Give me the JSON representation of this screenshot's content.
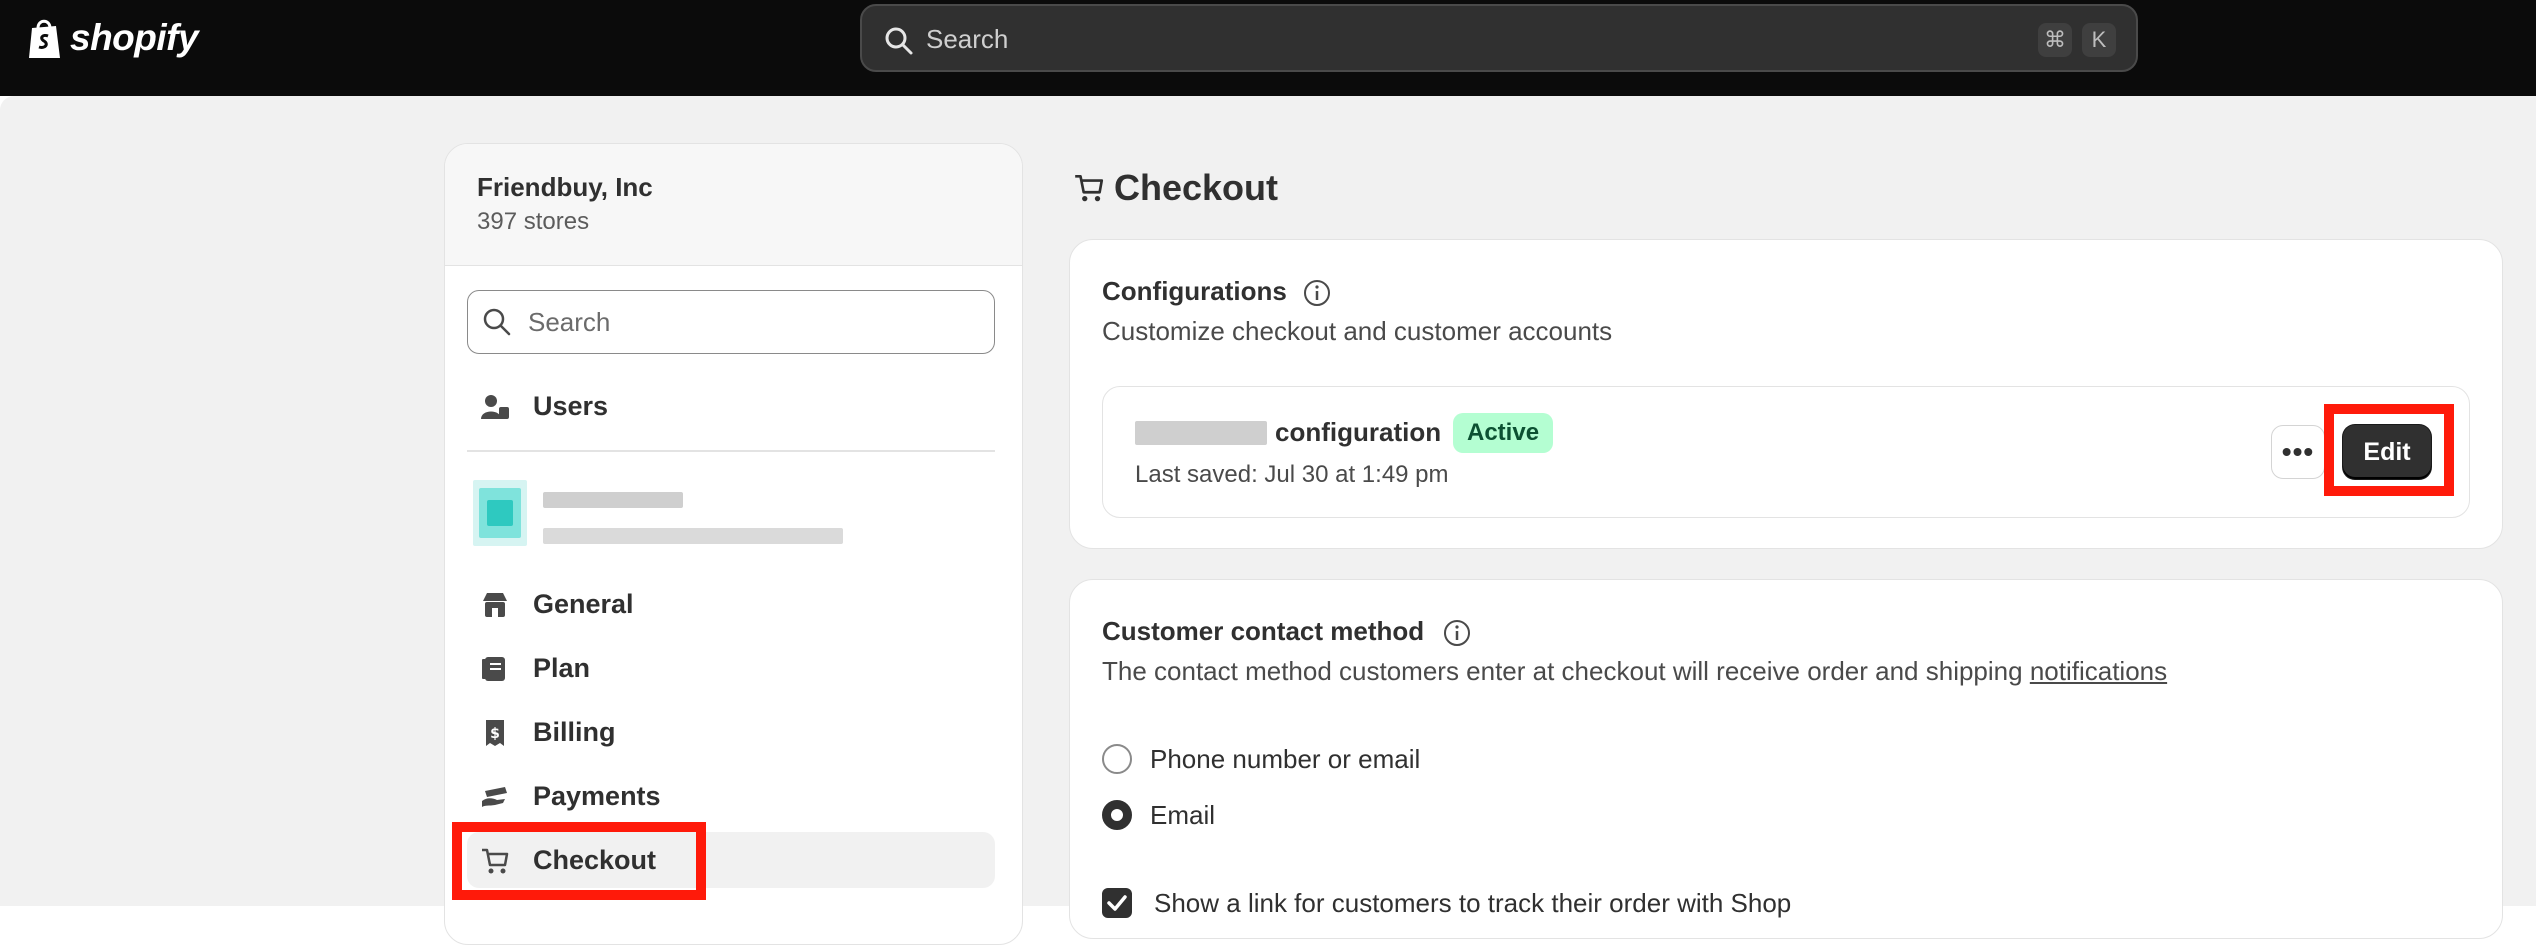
{
  "topbar": {
    "brand": "shopify",
    "search_placeholder": "Search",
    "shortcut_cmd": "⌘",
    "shortcut_key": "K"
  },
  "sidebar": {
    "org_name": "Friendbuy, Inc",
    "store_count": "397 stores",
    "search_placeholder": "Search",
    "items": [
      {
        "label": "Users",
        "icon": "users-icon"
      },
      {
        "label": "General",
        "icon": "store-icon"
      },
      {
        "label": "Plan",
        "icon": "plan-icon"
      },
      {
        "label": "Billing",
        "icon": "receipt-icon"
      },
      {
        "label": "Payments",
        "icon": "payments-icon"
      },
      {
        "label": "Checkout",
        "icon": "cart-icon",
        "active": true
      }
    ]
  },
  "main": {
    "title": "Checkout",
    "configurations": {
      "title": "Configurations",
      "subtitle": "Customize checkout and customer accounts",
      "config_name_suffix": "configuration",
      "status": "Active",
      "last_saved": "Last saved: Jul 30 at 1:49 pm",
      "more_label": "•••",
      "edit_label": "Edit"
    },
    "contact": {
      "title": "Customer contact method",
      "description_prefix": "The contact method customers enter at checkout will receive order and shipping ",
      "description_link": "notifications",
      "options": [
        {
          "label": "Phone number or email",
          "selected": false
        },
        {
          "label": "Email",
          "selected": true
        }
      ],
      "shop_tracking_label": "Show a link for customers to track their order with Shop"
    }
  },
  "colors": {
    "topbar": "#0b0b0b",
    "page_bg": "#f1f1f1",
    "highlight": "#ff1a0a",
    "badge_bg": "#b4fed2",
    "badge_text": "#0c5132"
  }
}
